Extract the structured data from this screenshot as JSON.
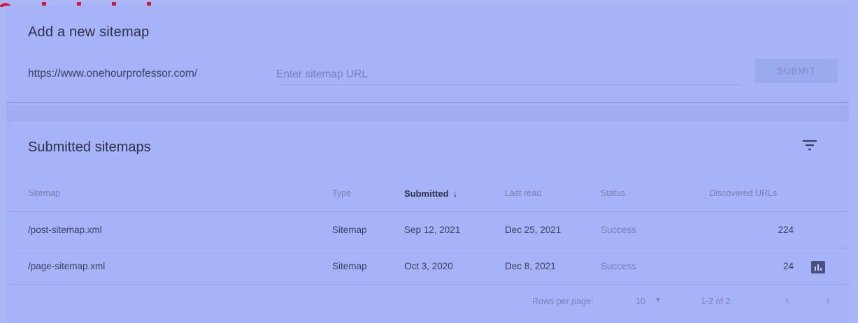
{
  "add_sitemap": {
    "title": "Add a new sitemap",
    "url_prefix": "https://www.onehourprofessor.com/",
    "input_placeholder": "Enter sitemap URL",
    "input_value": "",
    "submit_label": "SUBMIT"
  },
  "submitted": {
    "title": "Submitted sitemaps",
    "filter_icon": "filter-list-icon",
    "columns": {
      "sitemap": "Sitemap",
      "type": "Type",
      "submitted": "Submitted",
      "last_read": "Last read",
      "status": "Status",
      "discovered_urls": "Discovered URLs"
    },
    "sort_arrow": "↓",
    "rows": [
      {
        "sitemap": "/post-sitemap.xml",
        "type": "Sitemap",
        "submitted": "Sep 12, 2021",
        "last_read": "Dec 25, 2021",
        "status": "Success",
        "discovered_urls": "224"
      },
      {
        "sitemap": "/page-sitemap.xml",
        "type": "Sitemap",
        "submitted": "Oct 3, 2020",
        "last_read": "Dec 8, 2021",
        "status": "Success",
        "discovered_urls": "24",
        "action_icon": "bar-chart-icon"
      }
    ],
    "pagination": {
      "rows_per_page_label": "Rows per page:",
      "rows_per_page_value": "10",
      "range": "1-2 of 2",
      "prev": "‹",
      "next": "›"
    }
  },
  "colors": {
    "background": "#aab6f6",
    "card": "#a7b3f8",
    "brand_red": "#d4143a"
  }
}
